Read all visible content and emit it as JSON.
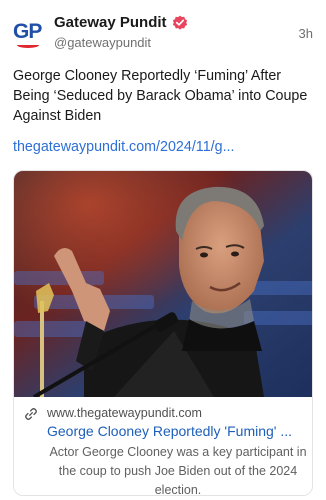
{
  "account": {
    "name": "Gateway Pundit",
    "handle": "@gatewaypundit",
    "avatar_text": "GP",
    "time": "3h",
    "verified_icon": "verified-badge-icon"
  },
  "post": {
    "text": "George Clooney Reportedly ‘Fuming’ After Being ‘Seduced by Barack Obama’ into Coupe Against Biden",
    "link": "thegatewaypundit.com/2024/11/g..."
  },
  "card": {
    "image_desc": "photo",
    "domain": "www.thegatewaypundit.com",
    "title": "George Clooney Reportedly 'Fuming' ...",
    "description": "Actor George Clooney was a key participant in the coup to push Joe Biden out of the 2024 election."
  },
  "colors": {
    "link": "#2d6fd6",
    "brand_blue": "#1f4fa6",
    "brand_red": "#e0282e",
    "verified": "#e8455f"
  }
}
